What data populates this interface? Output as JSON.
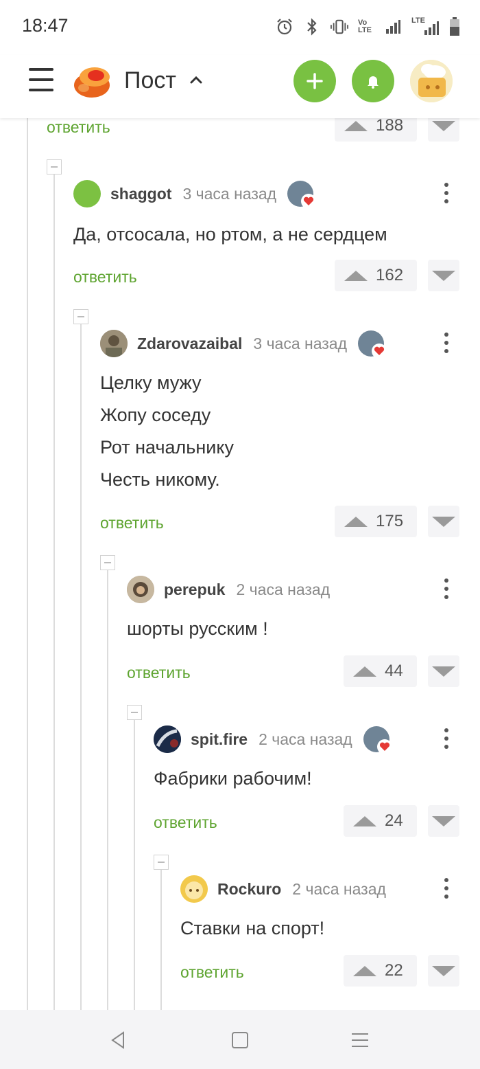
{
  "status_bar": {
    "time": "18:47",
    "icons": [
      "alarm-icon",
      "bluetooth-icon",
      "vibrate-icon",
      "volte-icon",
      "signal-icon",
      "lte-signal-icon",
      "battery-icon"
    ],
    "volte_text": "Vo LTE",
    "lte_text": "LTE"
  },
  "header": {
    "title": "Пост",
    "menu_icon": "hamburger-icon",
    "accent_color": "#79c142"
  },
  "comments": [
    {
      "id": "c0",
      "reply_label": "ответить",
      "votes": "188"
    },
    {
      "id": "c1",
      "username": "shaggot",
      "time": "3 часа назад",
      "text_lines": [
        "Да, отсосала, но ртом, а не сердцем"
      ],
      "reply_label": "ответить",
      "votes": "162"
    },
    {
      "id": "c2",
      "username": "Zdarovazaibal",
      "time": "3 часа назад",
      "text_lines": [
        "Целку мужу",
        "Жопу соседу",
        "Рот начальнику",
        "Честь никому."
      ],
      "reply_label": "ответить",
      "votes": "175"
    },
    {
      "id": "c3",
      "username": "perepuk",
      "time": "2 часа назад",
      "text_lines": [
        "шорты русским !"
      ],
      "reply_label": "ответить",
      "votes": "44"
    },
    {
      "id": "c4",
      "username": "spit.fire",
      "time": "2 часа назад",
      "text_lines": [
        "Фабрики рабочим!"
      ],
      "reply_label": "ответить",
      "votes": "24"
    },
    {
      "id": "c5",
      "username": "Rockuro",
      "time": "2 часа назад",
      "text_lines": [
        "Ставки на спорт!"
      ],
      "reply_label": "ответить",
      "votes": "22"
    }
  ],
  "nav_bar": {
    "buttons": [
      "back-icon",
      "home-icon",
      "recents-icon"
    ]
  }
}
